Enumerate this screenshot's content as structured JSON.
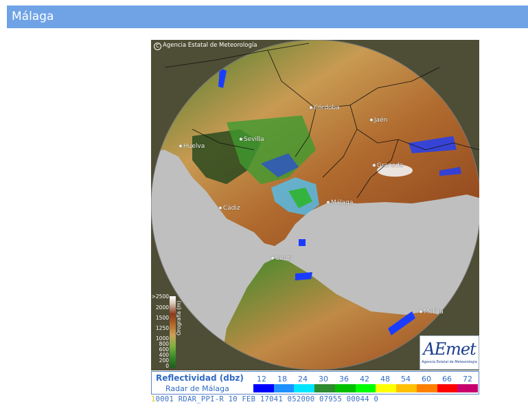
{
  "page": {
    "title": "Málaga"
  },
  "map": {
    "copyright": "Agencia Estatal de Meteorología",
    "copyright_symbol": "C",
    "cities": [
      {
        "name": "Córdoba",
        "id": "cordoba"
      },
      {
        "name": "Jaén",
        "id": "jaen"
      },
      {
        "name": "Sevilla",
        "id": "sevilla"
      },
      {
        "name": "Huelva",
        "id": "huelva"
      },
      {
        "name": "Granada",
        "id": "granada"
      },
      {
        "name": "Málaga",
        "id": "malaga"
      },
      {
        "name": "Cádiz",
        "id": "cadiz"
      },
      {
        "name": "Ceuta",
        "id": "ceuta"
      },
      {
        "name": "Melilla",
        "id": "melilla"
      }
    ],
    "colors": {
      "sea": "#bfbfbf",
      "dark": "#222222",
      "lowland": "#2f7d2a",
      "hills": "#c89a52",
      "mountain": "#9a4a1c",
      "peak": "#ffffff",
      "echo_blue": "#1a3cff",
      "echo_cyan": "#4cc6ff",
      "echo_green": "#2fb52f"
    }
  },
  "orography": {
    "title": "Orografía (m)",
    "ticks": [
      ">2500",
      "2000",
      "1500",
      "1250",
      "1000",
      "800",
      "600",
      "400",
      "200",
      "0"
    ]
  },
  "logo": {
    "text": "AEmet",
    "subtitle": "Agencia Estatal de Meteorología"
  },
  "legend": {
    "title": "Reflectividad (dbz)",
    "subtitle": "Radar de Málaga",
    "values": [
      "12",
      "18",
      "24",
      "30",
      "36",
      "42",
      "48",
      "54",
      "60",
      "66",
      "72"
    ],
    "colors": [
      "#0000ff",
      "#1e90ff",
      "#00e5ff",
      "#2e8b2e",
      "#00c000",
      "#00ff00",
      "#ffff00",
      "#ffc000",
      "#ff8000",
      "#ff0000",
      "#c8006e"
    ]
  },
  "ticker": {
    "lead": "1",
    "text": "0001 RDAR_PPI-R   10 FEB 17041 052000 07955 00044 0"
  }
}
